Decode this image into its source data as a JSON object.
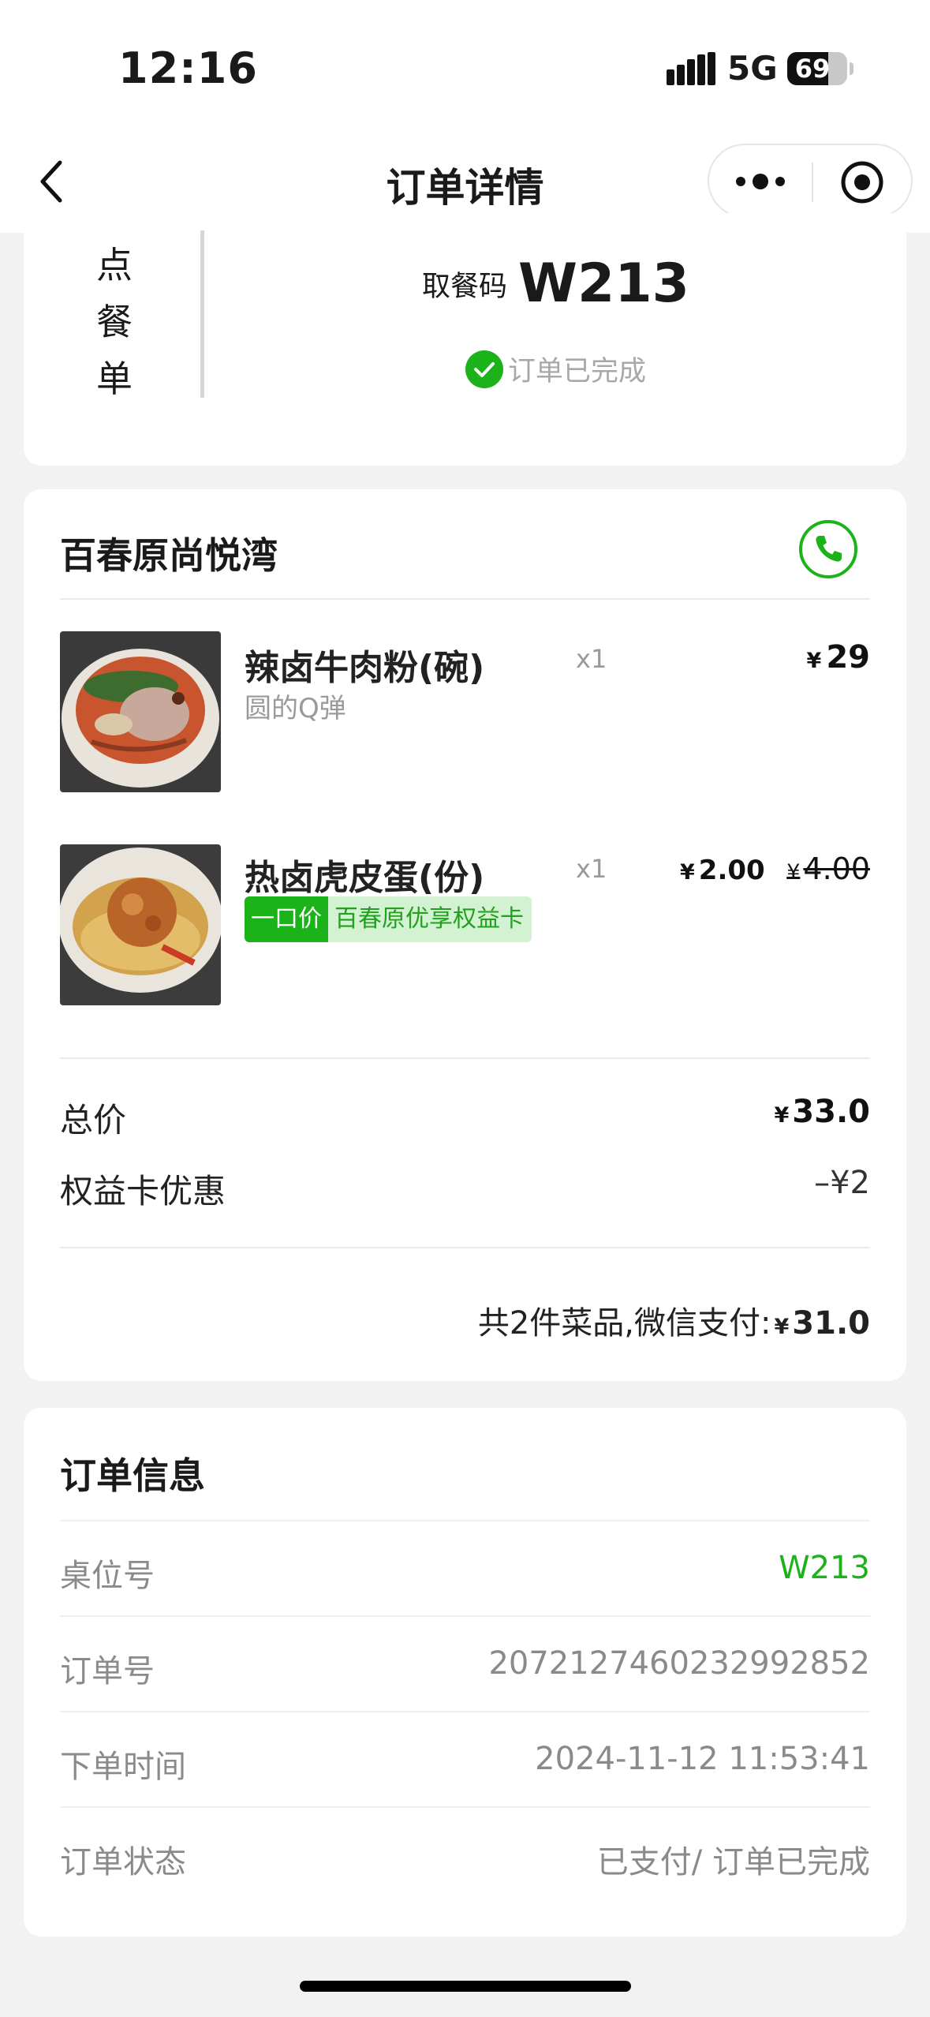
{
  "status_bar": {
    "time": "12:16",
    "network": "5G",
    "battery": "69",
    "battery_level": 0.69
  },
  "nav": {
    "title": "订单详情",
    "icons": [
      "back-chevron-icon",
      "more-dots-icon",
      "target-icon"
    ]
  },
  "pickup": {
    "side_label": [
      "点",
      "餐",
      "单"
    ],
    "code_label": "取餐码",
    "code": "W213",
    "status": "订单已完成"
  },
  "store": {
    "name": "百春原尚悦湾",
    "phone_icon": "phone-icon"
  },
  "items": [
    {
      "name": "辣卤牛肉粉(碗)",
      "desc": "圆的Q弹",
      "qty": "x1",
      "currency": "¥",
      "price": "29"
    },
    {
      "name": "热卤虎皮蛋(份)",
      "qty": "x1",
      "currency": "¥",
      "price": "2.00",
      "original_price": "4.00",
      "tag_label": "一口价",
      "tag_text": "百春原优享权益卡"
    }
  ],
  "summary": {
    "total_label": "总价",
    "total_currency": "¥",
    "total": "33.0",
    "discount_label": "权益卡优惠",
    "discount": "–¥2",
    "payment_prefix": "共2件菜品,微信支付:",
    "payment_currency": "¥",
    "payment": "31.0"
  },
  "order_info": {
    "title": "订单信息",
    "rows": [
      {
        "label": "桌位号",
        "value": "W213"
      },
      {
        "label": "订单号",
        "value": "2072127460232992852"
      },
      {
        "label": "下单时间",
        "value": "2024-11-12 11:53:41"
      },
      {
        "label": "订单状态",
        "value": "已支付/ 订单已完成"
      }
    ]
  },
  "colors": {
    "accent_green": "#1bb319",
    "tag_bg": "#d3f2d2",
    "page_bg": "#f2f2f2"
  }
}
